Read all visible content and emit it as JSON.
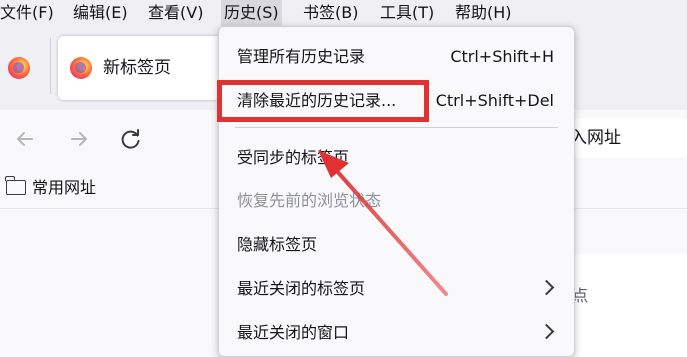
{
  "menubar": {
    "items": [
      "文件(F)",
      "编辑(E)",
      "查看(V)",
      "历史(S)",
      "书签(B)",
      "工具(T)",
      "帮助(H)"
    ],
    "active_index": 3
  },
  "tabs": {
    "pinned_icon": "firefox-icon",
    "active_tab_label": "新标签页",
    "active_tab_icon": "firefox-icon"
  },
  "navbar": {
    "back_icon": "back-arrow-icon",
    "forward_icon": "forward-arrow-icon",
    "reload_icon": "reload-icon",
    "url_text_partial": "入网址"
  },
  "bookmarks": {
    "folder_icon": "folder-icon",
    "folder_label": "常用网址"
  },
  "history_menu": {
    "items": [
      {
        "label": "管理所有历史记录",
        "accel": "Ctrl+Shift+H",
        "disabled": false,
        "submenu": false
      },
      {
        "label": "清除最近的历史记录...",
        "accel": "Ctrl+Shift+Del",
        "disabled": false,
        "submenu": false
      },
      {
        "label": "受同步的标签页",
        "accel": "",
        "disabled": false,
        "submenu": false
      },
      {
        "label": "恢复先前的浏览状态",
        "accel": "",
        "disabled": true,
        "submenu": false
      },
      {
        "label": "隐藏标签页",
        "accel": "",
        "disabled": false,
        "submenu": false
      },
      {
        "label": "最近关闭的标签页",
        "accel": "",
        "disabled": false,
        "submenu": true
      },
      {
        "label": "最近关闭的窗口",
        "accel": "",
        "disabled": false,
        "submenu": true
      }
    ]
  },
  "content": {
    "partial_glyph": "点"
  },
  "annotation": {
    "highlight_color": "#e03232",
    "highlighted_item": "清除最近的历史记录..."
  }
}
